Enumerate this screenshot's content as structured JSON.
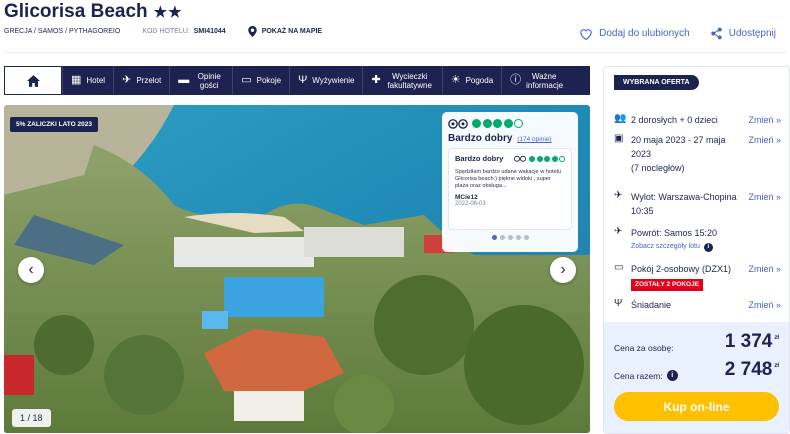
{
  "hotel": {
    "name": "Glicorisa Beach",
    "stars": "★★",
    "location": "GRECJA / SAMOS / PYTHAGOREIO",
    "code_label": "KOD HOTELU:",
    "code_value": "SMI41044",
    "map_label": "POKAŻ NA MAPIE"
  },
  "actions": {
    "favorite": "Dodaj do ulubionych",
    "share": "Udostępnij"
  },
  "nav": {
    "items": [
      {
        "label": "Hotel",
        "icon": "hotel-icon"
      },
      {
        "label": "Przelot",
        "icon": "plane-icon"
      },
      {
        "label": "Opinie gości",
        "icon": "chat-icon"
      },
      {
        "label": "Pokoje",
        "icon": "bed-icon"
      },
      {
        "label": "Wyżywienie",
        "icon": "cutlery-icon"
      },
      {
        "label": "Wycieczki fakultatywne",
        "icon": "palm-icon"
      },
      {
        "label": "Pogoda",
        "icon": "sun-icon"
      },
      {
        "label": "Ważne informacje",
        "icon": "info-icon"
      }
    ]
  },
  "gallery": {
    "promo": "5% ZALICZKI LATO 2023",
    "counter": "1 / 18"
  },
  "review": {
    "rating_label": "Bardzo dobry",
    "count": "(174 opinie)",
    "inner_title": "Bardzo dobry",
    "text": "Spędziłam bardzo udane wakacje w hotelu Glicorisa beach:) piękne widoki , super plaża oraz obsługa...",
    "author": "MCie12",
    "date": "2022-06-03"
  },
  "offer": {
    "tag": "WYBRANA OFERTA",
    "guests": "2 dorosłych + 0 dzieci",
    "dates": "20 maja 2023 - 27 maja 2023",
    "nights": "(7 nocległów)",
    "departure": "Wylot: Warszawa-Chopina 10:35",
    "return": "Powrót: Samos 15:20",
    "flight_details": "Zobacz szczegóły lotu",
    "room": "Pokój 2-osobowy (DZX1)",
    "rooms_left": "ZOSTAŁY 2 POKOJE",
    "board": "Śniadanie",
    "change": "Zmień",
    "price_per_person_label": "Cena za osobę:",
    "price_per_person": "1 374",
    "total_label": "Cena razem:",
    "total": "2 748",
    "currency": "zł",
    "buy": "Kup on-line"
  },
  "colors": {
    "navy": "#1d2350",
    "accent_blue": "#4a63c9",
    "buy_yellow": "#ffc000",
    "tripadvisor_green": "#00aa6c",
    "alert_red": "#e2001a"
  }
}
